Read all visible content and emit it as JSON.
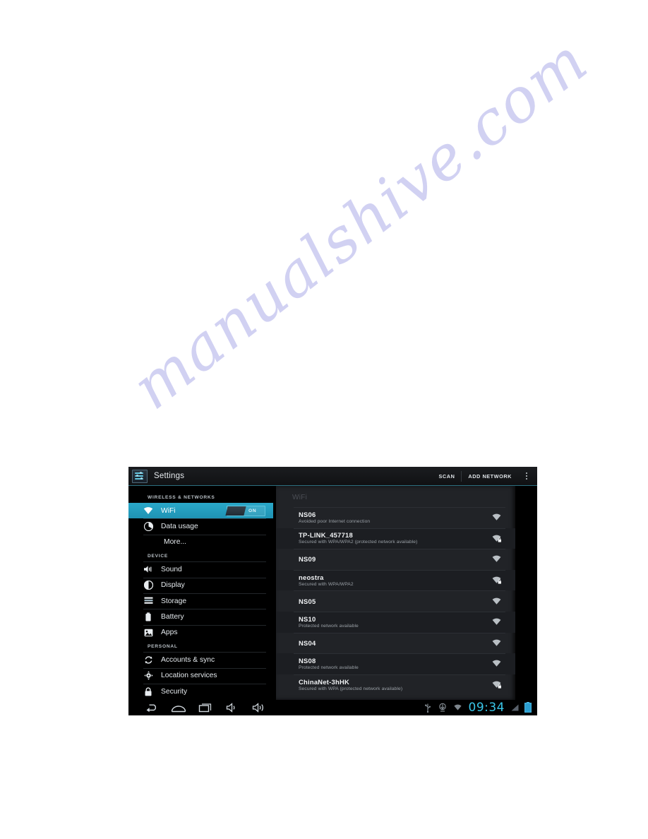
{
  "watermark": {
    "text": "manualshive.com",
    "color": "#c9caf0"
  },
  "device": {
    "action_bar": {
      "app_icon": "settings-sliders-icon",
      "title": "Settings",
      "scan_label": "SCAN",
      "add_network_label": "ADD NETWORK",
      "overflow_label": "overflow-menu-icon"
    },
    "sidebar": {
      "sections": [
        {
          "header": "WIRELESS & NETWORKS",
          "items": [
            {
              "label": "WiFi",
              "icon": "wifi-icon",
              "selected": true,
              "toggle": {
                "state": "ON"
              }
            },
            {
              "label": "Data usage",
              "icon": "pie-chart-icon",
              "selected": false
            },
            {
              "label": "More...",
              "icon": null,
              "selected": false
            }
          ]
        },
        {
          "header": "DEVICE",
          "items": [
            {
              "label": "Sound",
              "icon": "speaker-icon",
              "selected": false
            },
            {
              "label": "Display",
              "icon": "brightness-icon",
              "selected": false
            },
            {
              "label": "Storage",
              "icon": "storage-list-icon",
              "selected": false
            },
            {
              "label": "Battery",
              "icon": "battery-icon",
              "selected": false
            },
            {
              "label": "Apps",
              "icon": "apps-image-icon",
              "selected": false
            }
          ]
        },
        {
          "header": "PERSONAL",
          "items": [
            {
              "label": "Accounts & sync",
              "icon": "sync-icon",
              "selected": false
            },
            {
              "label": "Location services",
              "icon": "location-icon",
              "selected": false
            },
            {
              "label": "Security",
              "icon": "lock-icon",
              "selected": false
            }
          ]
        }
      ]
    },
    "wifi_panel": {
      "title": "WiFi",
      "networks": [
        {
          "name": "NS06",
          "status": "Avoided poor Internet connection",
          "secured": false
        },
        {
          "name": "TP-LINK_457718",
          "status": "Secured with WPA/WPA2 (protected network available)",
          "secured": true
        },
        {
          "name": "NS09",
          "status": "",
          "secured": false
        },
        {
          "name": "neostra",
          "status": "Secured with WPA/WPA2",
          "secured": true
        },
        {
          "name": "NS05",
          "status": "",
          "secured": false
        },
        {
          "name": "NS10",
          "status": "Protected network available",
          "secured": false
        },
        {
          "name": "NS04",
          "status": "",
          "secured": false
        },
        {
          "name": "NS08",
          "status": "Protected network available",
          "secured": false
        },
        {
          "name": "ChinaNet-3hHK",
          "status": "Secured with WPA (protected network available)",
          "secured": true
        }
      ]
    },
    "system_bar": {
      "nav": [
        {
          "name": "back-icon"
        },
        {
          "name": "home-icon"
        },
        {
          "name": "recents-icon"
        },
        {
          "name": "volume-down-icon"
        },
        {
          "name": "volume-up-icon"
        }
      ],
      "status": [
        {
          "name": "usb-icon"
        },
        {
          "name": "download-icon"
        },
        {
          "name": "wifi-status-icon"
        }
      ],
      "clock": "09:34",
      "signal": "signal-bars-icon",
      "battery": "battery-status-icon",
      "clock_color": "#39c6e8"
    }
  }
}
